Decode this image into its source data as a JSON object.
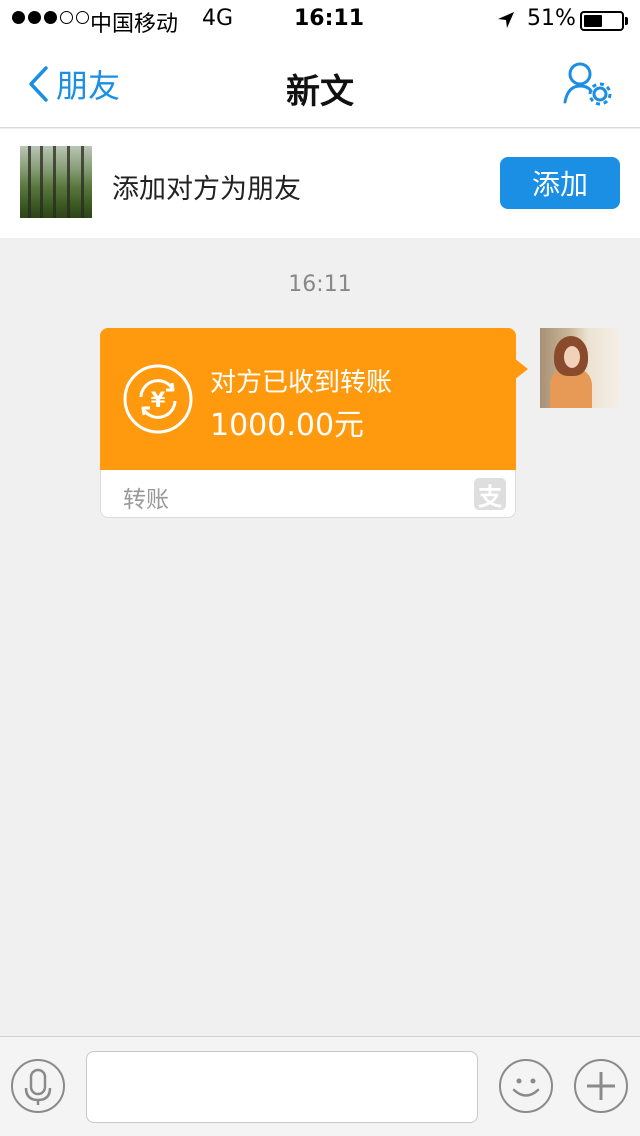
{
  "status_bar": {
    "carrier": "中国移动",
    "network": "4G",
    "time": "16:11",
    "battery_percent": "51%",
    "battery_level": 0.51,
    "signal_bars_filled": 3,
    "signal_bars_total": 5
  },
  "nav": {
    "back_label": "朋友",
    "title": "新文",
    "back_icon": "chevron-left-icon",
    "settings_icon": "person-settings-icon"
  },
  "add_banner": {
    "text": "添加对方为朋友",
    "button_label": "添加"
  },
  "chat": {
    "timestamp": "16:11",
    "transfer": {
      "status": "对方已收到转账",
      "amount": "1000.00元",
      "label": "转账",
      "icon": "yuan-transfer-icon",
      "brand_icon": "alipay-icon"
    }
  },
  "input_bar": {
    "message_value": "",
    "icons": [
      "microphone-icon",
      "smiley-icon",
      "plus-icon"
    ]
  },
  "colors": {
    "accent": "#1a8fe3",
    "transfer": "#ff9a0e",
    "background": "#f0f0f0"
  }
}
